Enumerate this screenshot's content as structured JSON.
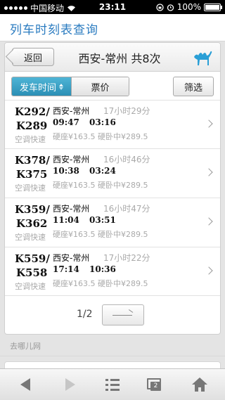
{
  "status_bar": {
    "carrier": "中国移动",
    "time": "23:11",
    "battery": "100%"
  },
  "header": {
    "title": "列车时刻表查询"
  },
  "card": {
    "back_label": "返回",
    "route_title": "西安-常州 共8次"
  },
  "filters": {
    "sort_time_label": "发车时间",
    "price_label": "票价",
    "filter_label": "筛选"
  },
  "trains": [
    {
      "code1": "K292/",
      "code2": "K289",
      "tag": "空调快速",
      "route": "西安-常州",
      "duration": "17小时29分",
      "depart": "09:47",
      "arrive": "03:16",
      "prices": "硬座¥163.5 硬卧中¥289.5"
    },
    {
      "code1": "K378/",
      "code2": "K375",
      "tag": "空调快速",
      "route": "西安-常州",
      "duration": "16小时46分",
      "depart": "10:38",
      "arrive": "03:24",
      "prices": "硬座¥163.5 硬卧中¥289.5"
    },
    {
      "code1": "K359/",
      "code2": "K362",
      "tag": "空调快速",
      "route": "西安-常州",
      "duration": "16小时47分",
      "depart": "11:04",
      "arrive": "03:51",
      "prices": "硬座¥163.5 硬卧中¥289.5"
    },
    {
      "code1": "K559/",
      "code2": "K558",
      "tag": "空调快速",
      "route": "西安-常州",
      "duration": "17小时22分",
      "depart": "17:14",
      "arrive": "10:36",
      "prices": "硬座¥163.5 硬卧中¥289.5"
    }
  ],
  "pager": {
    "page": "1/2"
  },
  "footer": {
    "source": "去哪儿网"
  },
  "toolbar": {
    "tabs_count": "2"
  },
  "colors": {
    "accent": "#2a7bc0",
    "sort_active": "#2b8fb5",
    "camel": "#2a9fd6"
  }
}
